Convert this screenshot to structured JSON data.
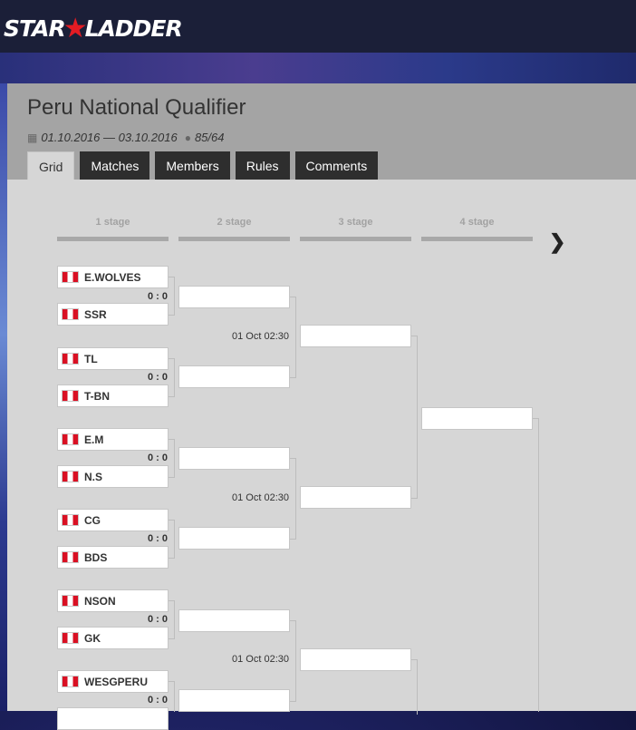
{
  "site": {
    "logo_part1": "STAR",
    "logo_part2": "LADDER"
  },
  "tournament": {
    "title": "Peru National Qualifier",
    "dates": "01.10.2016 — 03.10.2016",
    "participants": "85/64"
  },
  "tabs": [
    "Grid",
    "Matches",
    "Members",
    "Rules",
    "Comments"
  ],
  "active_tab": "Grid",
  "stages": [
    "1 stage",
    "2 stage",
    "3 stage",
    "4 stage"
  ],
  "icons": {
    "calendar": "calendar-icon",
    "user": "user-icon",
    "next": "chevron-right-icon"
  },
  "colors": {
    "header": "#a4a4a4",
    "tab_dark": "#2e2e2e",
    "bracket_bg": "#d6d6d6",
    "flag_red": "#d91023"
  },
  "round1": [
    {
      "team_a": "E.WOLVES",
      "team_b": "SSR",
      "score": "0 : 0"
    },
    {
      "team_a": "TL",
      "team_b": "T-BN",
      "score": "0 : 0"
    },
    {
      "team_a": "E.M",
      "team_b": "N.S",
      "score": "0 : 0"
    },
    {
      "team_a": "CG",
      "team_b": "BDS",
      "score": "0 : 0"
    },
    {
      "team_a": "NSON",
      "team_b": "GK",
      "score": "0 : 0"
    },
    {
      "team_a": "WESGPERU",
      "team_b": "",
      "score": "0 : 0"
    }
  ],
  "round2_times": [
    "01 Oct 02:30",
    "01 Oct 02:30",
    "01 Oct 02:30"
  ]
}
